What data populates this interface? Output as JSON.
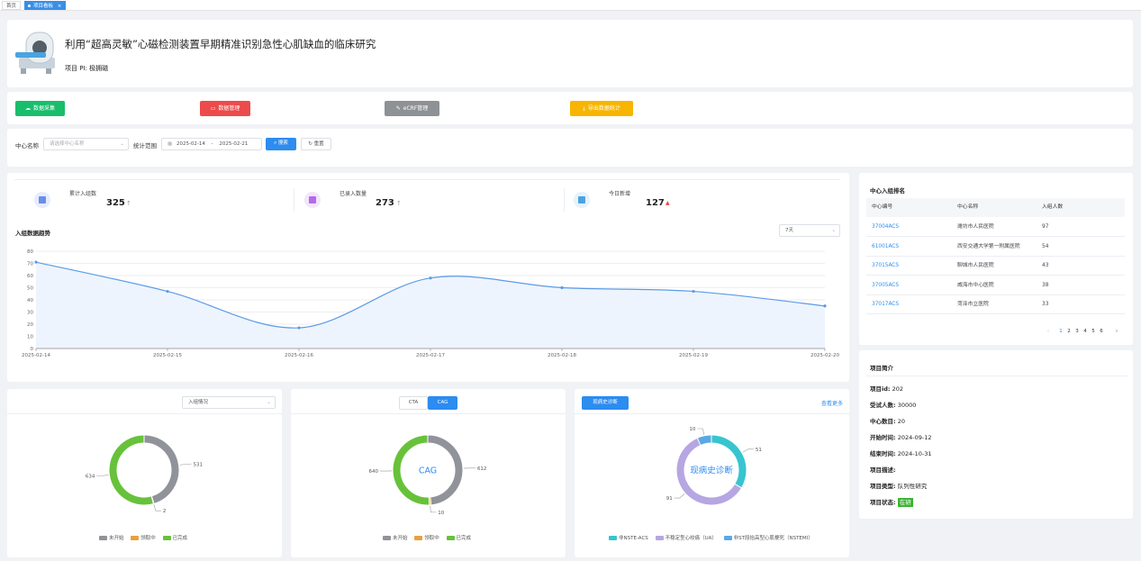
{
  "tabs": [
    {
      "label": "首页"
    },
    {
      "label": "项目看板"
    }
  ],
  "project": {
    "title": "利用“超高灵敏”心磁检测装置早期精准识别急性心肌缺血的临床研究",
    "pi": "项目 PI: 极拥磁"
  },
  "actions": {
    "collect": "数据采集",
    "manage": "数据管理",
    "ecrf": "eCRF管理",
    "export": "导出数据统计"
  },
  "filter": {
    "center_label": "中心名称",
    "center_placeholder": "请选择中心名称",
    "range_label": "统计范围",
    "date_start": "2025-02-14",
    "date_sep": "-",
    "date_end": "2025-02-21",
    "search": "搜索",
    "reset": "重置"
  },
  "stats": [
    {
      "label": "累计入组数",
      "value": "325",
      "arrow": "↑",
      "arrow_color": "#999999"
    },
    {
      "label": "已录入数量",
      "value": "273",
      "arrow": "↑",
      "arrow_color": "#999999"
    },
    {
      "label": "今日新增",
      "value": "127",
      "arrow": "▲",
      "arrow_color": "#f04134"
    }
  ],
  "trend": {
    "title": "入组数据趋势",
    "period_select": "7天"
  },
  "chart_data": [
    {
      "type": "area",
      "title": "入组数据趋势",
      "categories": [
        "2025-02-14",
        "2025-02-15",
        "2025-02-16",
        "2025-02-17",
        "2025-02-18",
        "2025-02-19",
        "2025-02-20"
      ],
      "values": [
        71,
        47,
        17,
        58,
        50,
        47,
        35
      ],
      "ylim": [
        0,
        80
      ],
      "yticks": [
        0,
        10,
        20,
        30,
        40,
        50,
        60,
        70,
        80
      ],
      "grid": true,
      "color": "#5b9be8"
    },
    {
      "type": "pie",
      "labels": [
        "未开始",
        "领取中",
        "已完成"
      ],
      "values": [
        531,
        2,
        634
      ],
      "colors": [
        "#909399",
        "#e6a23c",
        "#67c23a"
      ],
      "legend": "bottom"
    },
    {
      "type": "pie",
      "center_label": "CAG",
      "labels": [
        "未开始",
        "领取中",
        "已完成"
      ],
      "values": [
        612,
        10,
        640
      ],
      "colors": [
        "#909399",
        "#e6a23c",
        "#67c23a"
      ],
      "legend": "bottom"
    },
    {
      "type": "pie",
      "center_label": "现病史诊断",
      "labels": [
        "非NSTE-ACS",
        "不稳定型心绞痛（UA）",
        "非ST段抬高型心肌梗死（NSTEMI）"
      ],
      "values": [
        51,
        91,
        10
      ],
      "colors": [
        "#36c5cf",
        "#b6a6e2",
        "#5aa8e6"
      ],
      "legend": "bottom"
    }
  ],
  "ranking": {
    "title": "中心入组排名",
    "headers": [
      "中心编号",
      "中心名称",
      "入组人数"
    ],
    "rows": [
      {
        "id": "37004ACS",
        "name": "潍坊市人民医院",
        "count": "97"
      },
      {
        "id": "61001ACS",
        "name": "西安交通大学第一附属医院",
        "count": "54"
      },
      {
        "id": "37015ACS",
        "name": "聊城市人民医院",
        "count": "43"
      },
      {
        "id": "37005ACS",
        "name": "威海市中心医院",
        "count": "38"
      },
      {
        "id": "37017ACS",
        "name": "菏泽市立医院",
        "count": "33"
      }
    ],
    "pager": {
      "prev": "‹",
      "pages": [
        "1",
        "2",
        "3",
        "4",
        "5",
        "6"
      ],
      "next": "›"
    }
  },
  "intro": {
    "title": "项目简介",
    "rows": [
      {
        "label": "项目id:",
        "value": "202"
      },
      {
        "label": "受试人数:",
        "value": "30000"
      },
      {
        "label": "中心数目:",
        "value": "20"
      },
      {
        "label": "开始时间:",
        "value": "2024-09-12"
      },
      {
        "label": "结束时间:",
        "value": "2024-10-31"
      },
      {
        "label": "项目描述:",
        "value": ""
      },
      {
        "label": "项目类型:",
        "value": "队列性研究"
      },
      {
        "label": "项目状态:",
        "value": "在研"
      }
    ]
  },
  "pie1": {
    "select": "入组情况"
  },
  "pie2": {
    "tab_cta": "CTA",
    "tab_cag": "CAG"
  },
  "pie3": {
    "button": "现病史诊断",
    "more": "查看更多"
  }
}
